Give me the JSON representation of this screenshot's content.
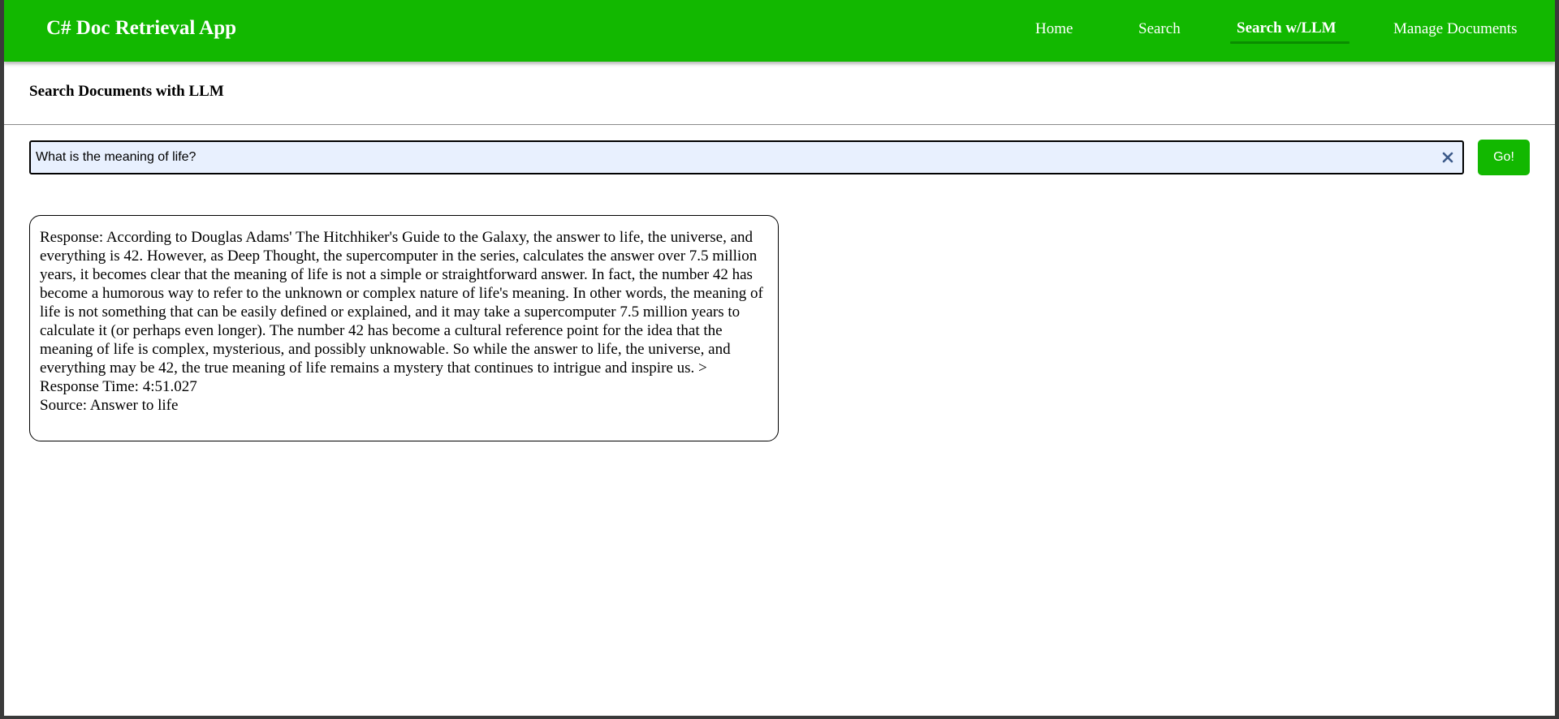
{
  "header": {
    "app_title": "C# Doc Retrieval App",
    "nav": [
      {
        "label": "Home"
      },
      {
        "label": "Search"
      },
      {
        "label": "Search w/LLM",
        "active": true
      },
      {
        "label": "Manage Documents"
      }
    ]
  },
  "page": {
    "heading": "Search Documents with LLM"
  },
  "search": {
    "value": "What is the meaning of life?",
    "go_label": "Go!",
    "clear_icon": "close-icon"
  },
  "result": {
    "response_label": "Response:",
    "response_text": "According to Douglas Adams' The Hitchhiker's Guide to the Galaxy, the answer to life, the universe, and everything is 42. However, as Deep Thought, the supercomputer in the series, calculates the answer over 7.5 million years, it becomes clear that the meaning of life is not a simple or straightforward answer. In fact, the number 42 has become a humorous way to refer to the unknown or complex nature of life's meaning. In other words, the meaning of life is not something that can be easily defined or explained, and it may take a supercomputer 7.5 million years to calculate it (or perhaps even longer). The number 42 has become a cultural reference point for the idea that the meaning of life is complex, mysterious, and possibly unknowable. So while the answer to life, the universe, and everything may be 42, the true meaning of life remains a mystery that continues to intrigue and inspire us. >",
    "response_time_label": "Response Time:",
    "response_time": "4:51.027",
    "source_label": "Source:",
    "source": "Answer to life"
  },
  "colors": {
    "accent": "#12b800",
    "active_underline": "#0a8d00",
    "input_background": "#e8f0fe",
    "clear_icon": "#3c5a8a"
  }
}
